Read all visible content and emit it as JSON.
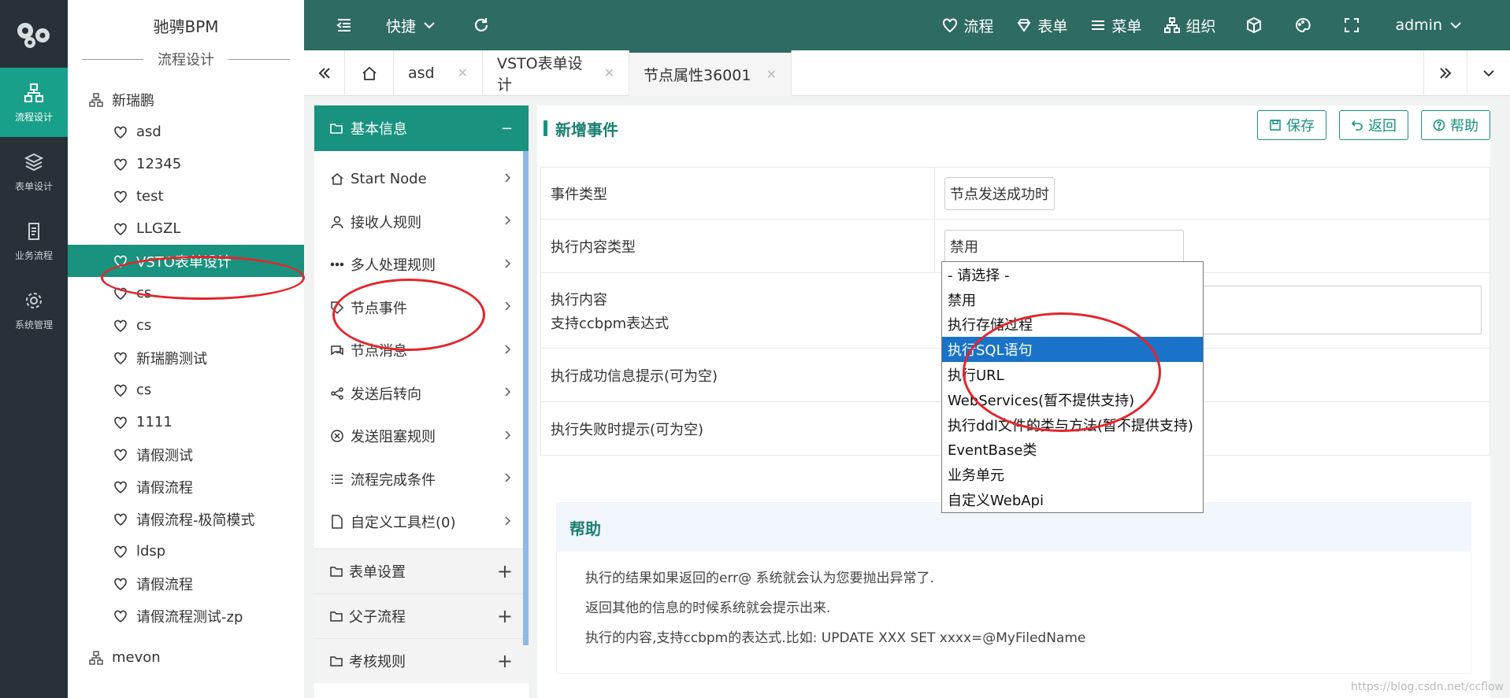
{
  "rail": {
    "items": [
      {
        "label": "流程设计",
        "icon": "org-chart-icon",
        "active": true
      },
      {
        "label": "表单设计",
        "icon": "layers-icon",
        "active": false
      },
      {
        "label": "业务流程",
        "icon": "document-icon",
        "active": false
      },
      {
        "label": "系统管理",
        "icon": "gear-icon",
        "active": false
      }
    ]
  },
  "tree": {
    "brand": "驰骋BPM",
    "section_title": "流程设计",
    "nodes": [
      {
        "label": "新瑞鹏",
        "type": "root"
      },
      {
        "label": "asd",
        "type": "leaf"
      },
      {
        "label": "12345",
        "type": "leaf"
      },
      {
        "label": "test",
        "type": "leaf"
      },
      {
        "label": "LLGZL",
        "type": "leaf"
      },
      {
        "label": "VSTO表单设计",
        "type": "leaf",
        "selected": true
      },
      {
        "label": "cs",
        "type": "leaf"
      },
      {
        "label": "cs",
        "type": "leaf"
      },
      {
        "label": "新瑞鹏测试",
        "type": "leaf"
      },
      {
        "label": "cs",
        "type": "leaf"
      },
      {
        "label": "1111",
        "type": "leaf"
      },
      {
        "label": "请假测试",
        "type": "leaf"
      },
      {
        "label": "请假流程",
        "type": "leaf"
      },
      {
        "label": "请假流程-极简模式",
        "type": "leaf"
      },
      {
        "label": "ldsp",
        "type": "leaf"
      },
      {
        "label": "请假流程",
        "type": "leaf"
      },
      {
        "label": "请假流程测试-zp",
        "type": "leaf"
      },
      {
        "label": "mevon",
        "type": "root"
      }
    ]
  },
  "topbar": {
    "shortcut": "快捷",
    "flow": "流程",
    "form": "表单",
    "menu": "菜单",
    "org": "组织",
    "user": "admin"
  },
  "tabs": [
    {
      "label": "asd"
    },
    {
      "label": "VSTO表单设计"
    },
    {
      "label": "节点属性36001",
      "active": true
    }
  ],
  "menu": {
    "header": "基本信息",
    "header_toggle": "−",
    "items": [
      {
        "label": "Start Node",
        "icon": "home-icon"
      },
      {
        "label": "接收人规则",
        "icon": "user-icon"
      },
      {
        "label": "多人处理规则",
        "icon": "more-icon"
      },
      {
        "label": "节点事件",
        "icon": "tag-icon"
      },
      {
        "label": "节点消息",
        "icon": "chat-icon"
      },
      {
        "label": "发送后转向",
        "icon": "share-icon"
      },
      {
        "label": "发送阻塞规则",
        "icon": "block-icon"
      },
      {
        "label": "流程完成条件",
        "icon": "list-icon"
      },
      {
        "label": "自定义工具栏(0)",
        "icon": "file-icon"
      }
    ],
    "groups": [
      {
        "label": "表单设置"
      },
      {
        "label": "父子流程"
      },
      {
        "label": "考核规则"
      }
    ]
  },
  "main": {
    "title": "新增事件",
    "buttons": {
      "save": "保存",
      "back": "返回",
      "help": "帮助"
    },
    "rows": [
      {
        "label": "事件类型",
        "value": "节点发送成功时"
      },
      {
        "label": "执行内容类型",
        "value": "禁用"
      },
      {
        "label": "执行内容",
        "label2": "支持ccbpm表达式"
      },
      {
        "label": "执行成功信息提示(可为空)"
      },
      {
        "label": "执行失败时提示(可为空)"
      }
    ]
  },
  "dropdown": {
    "options": [
      "- 请选择 -",
      "禁用",
      "执行存储过程",
      "执行SQL语句",
      "执行URL",
      "WebServices(暂不提供支持)",
      "执行ddl文件的类与方法(暂不提供支持)",
      "EventBase类",
      "业务单元",
      "自定义WebApi"
    ],
    "highlighted": "执行SQL语句"
  },
  "help": {
    "title": "帮助",
    "lines": [
      "执行的结果如果返回的err@ 系统就会认为您要抛出异常了.",
      "返回其他的信息的时候系统就会提示出来.",
      "执行的内容,支持ccbpm的表达式.比如: UPDATE XXX SET xxxx=@MyFiledName"
    ]
  },
  "watermark": "https://blog.csdn.net/ccflow",
  "colors": {
    "teal": "#19927f",
    "topbar": "#2e6b62",
    "rail": "#263238",
    "annotation": "#e3262b",
    "highlight": "#1a73c9"
  }
}
